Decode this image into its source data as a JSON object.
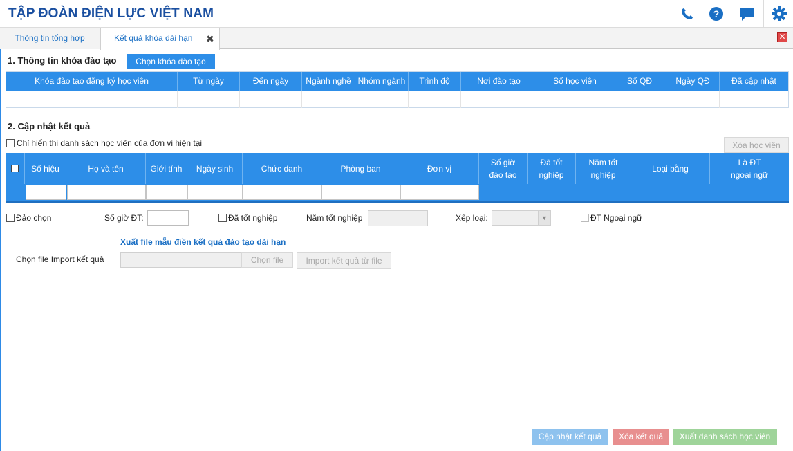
{
  "header": {
    "title": "TẬP ĐOÀN ĐIỆN LỰC VIỆT NAM",
    "icons": [
      "phone-icon",
      "help-icon",
      "chat-icon",
      "gear-icon"
    ],
    "accent": "#1a4fa0"
  },
  "tabs": [
    {
      "label": "Thông tin tổng hợp",
      "active": false
    },
    {
      "label": "Kết quả khóa dài hạn",
      "active": true,
      "close": "✖"
    }
  ],
  "window_close": "✕",
  "section1": {
    "title": "1. Thông tin khóa đào tạo",
    "select_button": "Chọn khóa đào tạo",
    "columns": [
      "Khóa đào tạo đăng ký học viên",
      "Từ ngày",
      "Đến ngày",
      "Ngành nghề",
      "Nhóm ngành",
      "Trình độ",
      "Nơi đào tạo",
      "Số học viên",
      "Số QĐ",
      "Ngày QĐ",
      "Đã cập nhật"
    ]
  },
  "section2": {
    "title": "2. Cập nhật kết quả",
    "filter_label": "Chỉ hiển thị danh sách học viên của đơn vị hiện tại",
    "delete_button": "Xóa học viên",
    "columns": [
      "Số hiệu",
      "Họ và tên",
      "Giới tính",
      "Ngày sinh",
      "Chức danh",
      "Phòng ban",
      "Đơn vị",
      "Số giờ đào tạo",
      "Đã tốt nghiệp",
      "Năm tốt nghiệp",
      "Loại bằng",
      "Là ĐT ngoại ngữ"
    ]
  },
  "options": {
    "invert_select": "Đảo chọn",
    "hours_label": "Số giờ ĐT:",
    "hours_value": "",
    "graduated": "Đã tốt nghiệp",
    "grad_year_label": "Năm tốt nghiệp",
    "rank_label": "Xếp loại:",
    "rank_value": "",
    "foreign_lang": "ĐT Ngoại ngữ"
  },
  "import": {
    "template_link": "Xuất file mẫu điền kết quả đào tạo dài hạn",
    "label": "Chọn file Import kết quả",
    "choose_file": "Chọn file",
    "import_button": "Import kết quả từ file"
  },
  "footer": {
    "update_button": "Cập nhật kết quả",
    "delete_button": "Xóa kết quả",
    "export_button": "Xuất danh sách học viên",
    "colors": {
      "update": "#8ec2ee",
      "delete": "#e88f8f",
      "export": "#9fd49a"
    }
  }
}
